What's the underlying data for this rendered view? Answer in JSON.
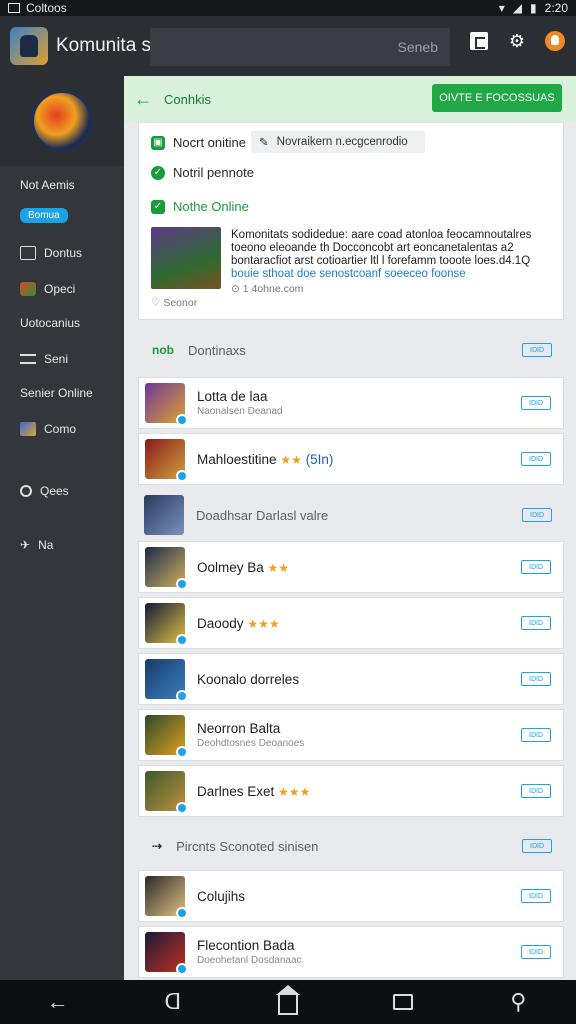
{
  "status": {
    "carrier": "Coltoos",
    "time": "2:20"
  },
  "appbar": {
    "title": "Komunita sane",
    "search_label": "Seneb"
  },
  "sidebar": {
    "items": [
      {
        "label": "Not Aemis",
        "icon": "none"
      },
      {
        "label": "Bomua",
        "icon": "pill"
      },
      {
        "label": "Dontus",
        "icon": "outline-square-icon"
      },
      {
        "label": "Opeci",
        "icon": "game-icon"
      },
      {
        "label": "Uotocanius",
        "icon": "none"
      },
      {
        "label": "Seni",
        "icon": "list-icon"
      },
      {
        "label": "Senier Online",
        "icon": "none"
      },
      {
        "label": "Como",
        "icon": "picture-icon"
      },
      {
        "label": "Qees",
        "icon": "circle-icon"
      },
      {
        "label": "Na",
        "icon": "pin-icon"
      }
    ]
  },
  "main": {
    "header": {
      "title": "Conhkis",
      "button_label": "OIVTE E FOCOSSUAS"
    },
    "card": {
      "row1": "Nocrt onitine",
      "tag": "Novraikern n.ecgcenrodio",
      "row2": "Notril pennote",
      "row3": "Nothe Online",
      "news_line1": "Komonitats sodidedue: aare coad atonloa feocamnoutalres",
      "news_line2": "toeono eleoande th Docconcobt art eoncanetalentas a2",
      "news_line3": "bontaracfiot arst cotioartier ltl l forefamm tooote loes.d4.1Q",
      "news_link": "bouie sthoat doe senostcoanf soeeceo foonse",
      "news_meta": "1 4ohne.com",
      "news_foot": "Seonor"
    },
    "sections": [
      {
        "label": "Dontinaxs",
        "tag": "IDID"
      },
      {
        "label": "Doadhsar Darlasl valre",
        "tag": "IDID"
      },
      {
        "label": "Pircnts  Sconoted sinisen",
        "tag": "IDID"
      }
    ],
    "rows": [
      {
        "title": "Lotta de laa",
        "sub": "Naonalsen Deanad",
        "tag": "IDID"
      },
      {
        "title": "Mahloestitine",
        "stars": "★★",
        "rating": "(5In)",
        "tag": "IDID"
      },
      {
        "title": "Oolmey Ba",
        "stars": "★★",
        "tag": "IDID"
      },
      {
        "title": "Daoody",
        "stars": "★★★",
        "tag": "IDID"
      },
      {
        "title": "Koonalo dorreles",
        "tag": "IDID"
      },
      {
        "title": "Neorron Balta",
        "sub": "Deohdtosnes Deoanoes",
        "tag": "IDID"
      },
      {
        "title": "Darlnes Exet",
        "stars": "★★★",
        "tag": "IDID"
      },
      {
        "title": "Colujihs",
        "tag": "IDID"
      },
      {
        "title": "Flecontion Bada",
        "sub": "Doeohetanl Dosdanaac",
        "tag": "IDID"
      }
    ]
  },
  "colors": {
    "accent": "#21a846",
    "link": "#1a7fcf",
    "chip": "#1aa3e8"
  }
}
